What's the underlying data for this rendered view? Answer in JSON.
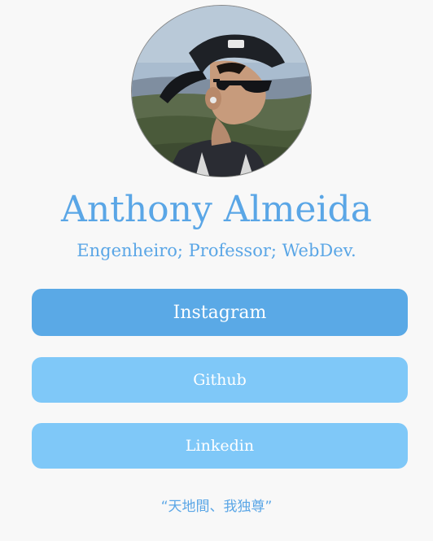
{
  "profile": {
    "name": "Anthony Almeida",
    "tagline": "Engenheiro; Professor; WebDev.",
    "quote": "“天地間、我独尊”"
  },
  "links": {
    "instagram": "Instagram",
    "github": "Github",
    "linkedin": "Linkedin"
  },
  "colors": {
    "accent": "#5aa6e6",
    "primary_button": "#5aa9e6",
    "secondary_button": "#7fc8f8",
    "background": "#f8f8f8"
  }
}
